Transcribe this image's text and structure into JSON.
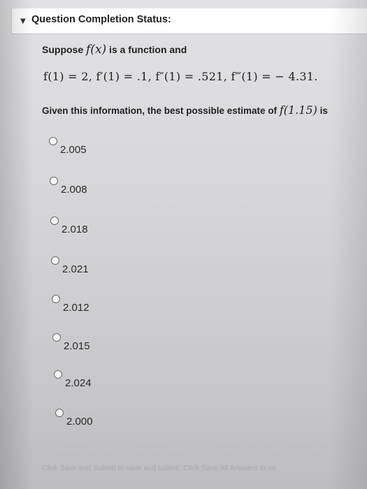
{
  "header": {
    "chevron_icon": "chevron-down-icon",
    "title": "Question Completion Status:"
  },
  "question": {
    "intro_prefix": "Suppose ",
    "intro_function": "f(x)",
    "intro_suffix": " is a function and",
    "equation": "f(1) = 2, f′(1) = .1, f″(1) = .521, f‴(1) = − 4.31.",
    "given_prefix": "Given this information, the best possible estimate of ",
    "given_function": "f(1.15)",
    "given_suffix": " is"
  },
  "options": [
    {
      "label": "2.005",
      "selected": false
    },
    {
      "label": "2.008",
      "selected": false
    },
    {
      "label": "2.018",
      "selected": false
    },
    {
      "label": "2.021",
      "selected": false
    },
    {
      "label": "2.012",
      "selected": false
    },
    {
      "label": "2.015",
      "selected": false
    },
    {
      "label": "2.024",
      "selected": false
    },
    {
      "label": "2.000",
      "selected": false
    }
  ],
  "footer": {
    "text": "Click Save and Submit to save and submit. Click Save All Answers to sa"
  }
}
